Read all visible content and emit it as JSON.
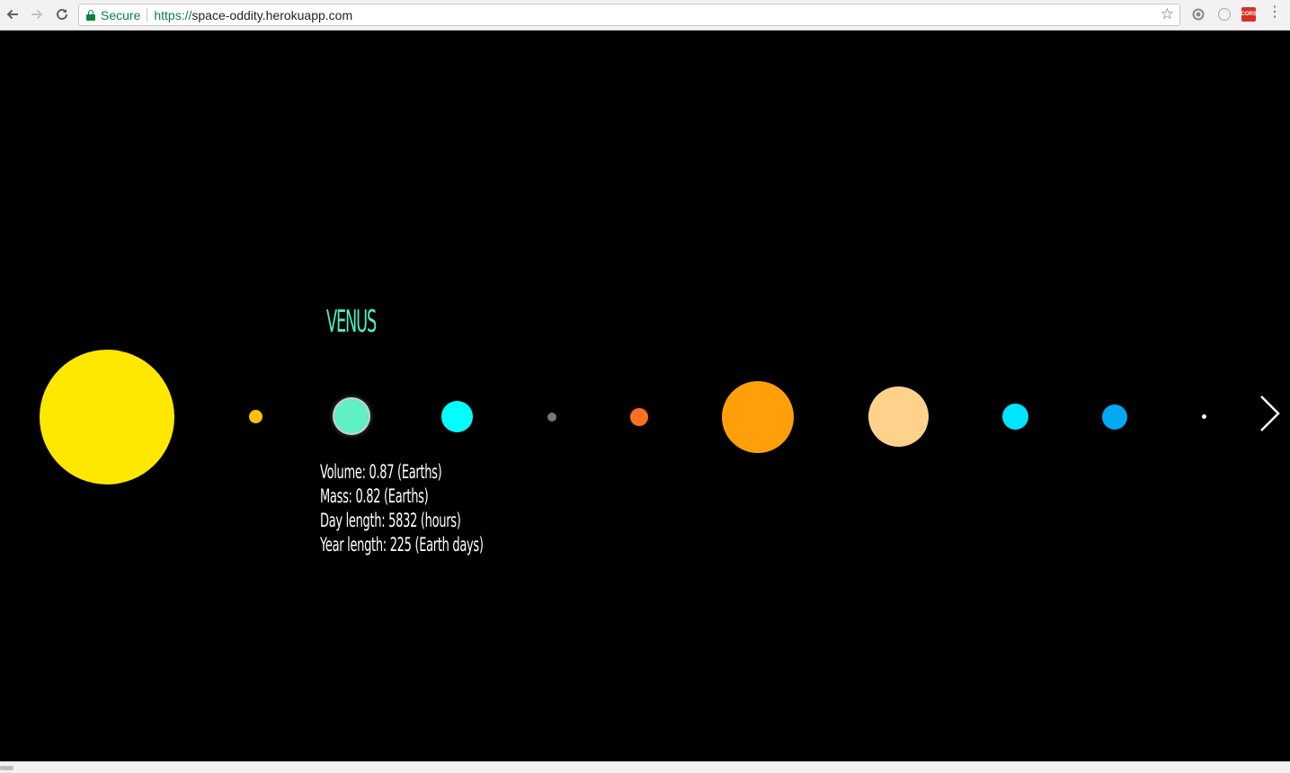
{
  "browser": {
    "secure_label": "Secure",
    "url_scheme": "https://",
    "url_host": "space-oddity.herokuapp.com",
    "extension_cors_label": "CORS"
  },
  "icons": {
    "back": "arrow-left-icon",
    "forward": "arrow-right-icon",
    "reload": "reload-icon",
    "lock": "lock-icon",
    "star": "star-icon",
    "extension_settings": "gear-icon",
    "extension_circle": "circle-icon",
    "menu": "kebab-menu-icon",
    "next": "chevron-right-icon"
  },
  "colors": {
    "background": "#000000",
    "title": "#4ef0c0",
    "info_text": "#ffffff",
    "secure_green": "#0b8043"
  },
  "solar_system": {
    "sun": {
      "name": "sun",
      "color": "#ffe800"
    },
    "planets": [
      {
        "name": "mercury",
        "color": "#ffc107"
      },
      {
        "name": "venus",
        "color": "#5ff0c4",
        "selected": true
      },
      {
        "name": "earth",
        "color": "#00ffff"
      },
      {
        "name": "moon",
        "color": "#777777"
      },
      {
        "name": "mars",
        "color": "#ff6f1f"
      },
      {
        "name": "jupiter",
        "color": "#ff9f0a"
      },
      {
        "name": "saturn",
        "color": "#ffd28c"
      },
      {
        "name": "uranus",
        "color": "#00e5ff"
      },
      {
        "name": "neptune",
        "color": "#03a9f4"
      },
      {
        "name": "pluto",
        "color": "#ffffff"
      }
    ]
  },
  "selected_planet": {
    "title": "VENUS",
    "volume": "Volume: 0.87 (Earths)",
    "mass": "Mass: 0.82 (Earths)",
    "day_length": "Day length: 5832 (hours)",
    "year_length": "Year length: 225 (Earth days)"
  }
}
